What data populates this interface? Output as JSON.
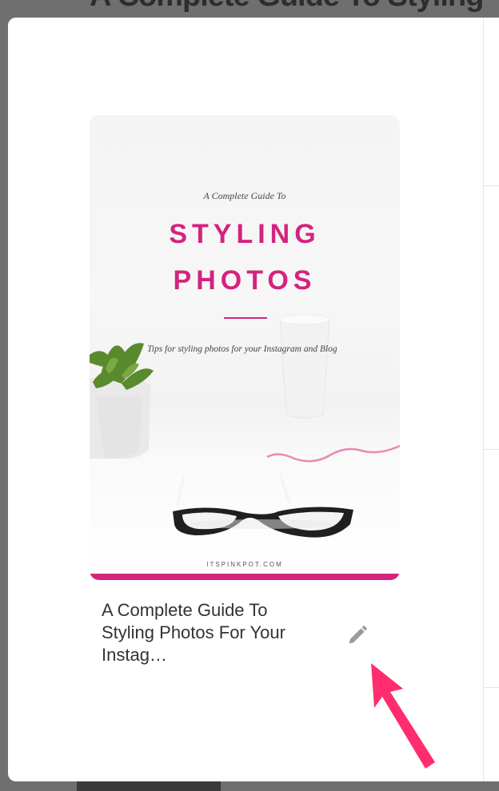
{
  "background": {
    "headline": "A Complete Guide To Styling"
  },
  "modal": {
    "pin": {
      "cover": {
        "kicker": "A Complete Guide To",
        "title_line1": "STYLING",
        "title_line2": "PHOTOS",
        "tagline": "Tips for styling photos for your Instagram and Blog",
        "site": "ITSPINKPOT.COM"
      },
      "title_lines": [
        "A Complete Guide To",
        "Styling Photos For Your",
        "Instag…"
      ],
      "edit_icon": "pencil-icon"
    },
    "annotation": {
      "icon": "arrow-pointer-icon",
      "color": "#ff2d6f"
    }
  },
  "colors": {
    "accent": "#d4237f",
    "overlay": "#6f6f6f",
    "arrow": "#ff2d6f",
    "text": "#333333",
    "icon": "#9b9b9b"
  }
}
